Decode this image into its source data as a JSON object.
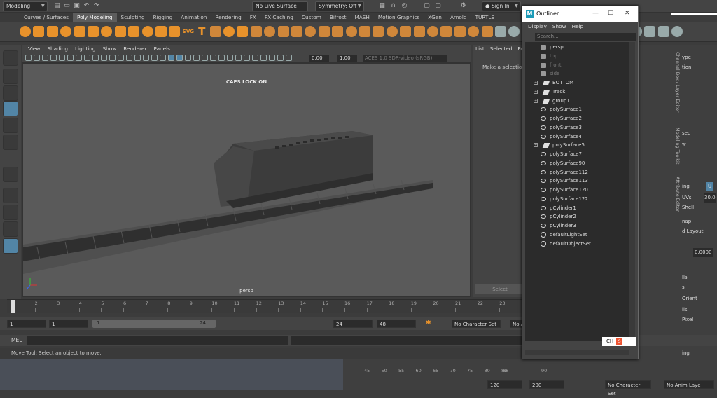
{
  "statusline": {
    "workspace": "Modeling",
    "live_surface": "No Live Surface",
    "symmetry": "Symmetry: Off",
    "sign_in": "Sign In"
  },
  "shelf_tabs": [
    "Curves / Surfaces",
    "Poly Modeling",
    "Sculpting",
    "Rigging",
    "Animation",
    "Rendering",
    "FX",
    "FX Caching",
    "Custom",
    "Bifrost",
    "MASH",
    "Motion Graphics",
    "XGen",
    "Arnold",
    "TURTLE"
  ],
  "shelf_active": "Poly Modeling",
  "shelf_text_icons": [
    "T",
    "SVG"
  ],
  "viewport": {
    "menus": [
      "View",
      "Shading",
      "Lighting",
      "Show",
      "Renderer",
      "Panels"
    ],
    "exposure": "0.00",
    "gamma": "1.00",
    "color_space": "ACES 1.0 SDR-video (sRGB)",
    "caps_lock": "CAPS LOCK ON",
    "camera_label": "persp"
  },
  "attribute_panel": {
    "tabs": [
      "List",
      "Selected",
      "Fo"
    ],
    "message": "Make a selection",
    "select_button": "Select",
    "copy_tab_button": "y Tab"
  },
  "timeline": {
    "ticks": [
      "1",
      "2",
      "3",
      "4",
      "5",
      "6",
      "7",
      "8",
      "9",
      "10",
      "11",
      "12",
      "13",
      "14",
      "15",
      "16",
      "17",
      "18",
      "19",
      "20",
      "21",
      "22",
      "23"
    ],
    "current_frame": "1"
  },
  "range": {
    "start": "1",
    "anim_start": "1",
    "slider_start": "1",
    "slider_end": "24",
    "anim_end": "24",
    "end": "48",
    "character_set": "No Character Set",
    "anim_layer": "No A"
  },
  "command_line": {
    "label": "MEL"
  },
  "help_line": "Move Tool: Select an object to move.",
  "outliner": {
    "title": "Outliner",
    "menus": [
      "Display",
      "Show",
      "Help"
    ],
    "search_placeholder": "Search...",
    "items": [
      {
        "label": "persp",
        "icon": "camera-icon",
        "expand": false,
        "dim": false
      },
      {
        "label": "top",
        "icon": "camera-icon",
        "expand": false,
        "dim": true
      },
      {
        "label": "front",
        "icon": "camera-icon",
        "expand": false,
        "dim": true
      },
      {
        "label": "side",
        "icon": "camera-icon",
        "expand": false,
        "dim": true
      },
      {
        "label": "BOTTOM",
        "icon": "group-icon",
        "expand": true,
        "dim": false
      },
      {
        "label": "Track",
        "icon": "group-icon",
        "expand": true,
        "dim": false
      },
      {
        "label": "group1",
        "icon": "group-icon",
        "expand": true,
        "dim": false
      },
      {
        "label": "polySurface1",
        "icon": "mesh-icon",
        "expand": false,
        "dim": false
      },
      {
        "label": "polySurface2",
        "icon": "mesh-icon",
        "expand": false,
        "dim": false
      },
      {
        "label": "polySurface3",
        "icon": "mesh-icon",
        "expand": false,
        "dim": false
      },
      {
        "label": "polySurface4",
        "icon": "mesh-icon",
        "expand": false,
        "dim": false
      },
      {
        "label": "polySurface5",
        "icon": "group-icon",
        "expand": true,
        "dim": false
      },
      {
        "label": "polySurface7",
        "icon": "mesh-icon",
        "expand": false,
        "dim": false
      },
      {
        "label": "polySurface90",
        "icon": "mesh-icon",
        "expand": false,
        "dim": false
      },
      {
        "label": "polySurface112",
        "icon": "mesh-icon",
        "expand": false,
        "dim": false
      },
      {
        "label": "polySurface113",
        "icon": "mesh-icon",
        "expand": false,
        "dim": false
      },
      {
        "label": "polySurface120",
        "icon": "mesh-icon",
        "expand": false,
        "dim": false
      },
      {
        "label": "polySurface122",
        "icon": "mesh-icon",
        "expand": false,
        "dim": false
      },
      {
        "label": "pCylinder1",
        "icon": "mesh-icon",
        "expand": false,
        "dim": false
      },
      {
        "label": "pCylinder2",
        "icon": "mesh-icon",
        "expand": false,
        "dim": false
      },
      {
        "label": "pCylinder3",
        "icon": "mesh-icon",
        "expand": false,
        "dim": false
      },
      {
        "label": "defaultLightSet",
        "icon": "set-icon",
        "expand": false,
        "dim": false
      },
      {
        "label": "defaultObjectSet",
        "icon": "set-icon",
        "expand": false,
        "dim": false
      }
    ],
    "ime_label": "CH"
  },
  "right_dock": {
    "rows": [
      "ype",
      "tion",
      "sed",
      "w",
      "ing",
      "UVs",
      "Shell",
      "nap",
      "d Layout",
      "0.0000",
      "lls",
      "s",
      "Orient",
      "lls",
      "Pixel",
      "ing"
    ],
    "uv_value": "30.0",
    "u_label": "U",
    "uv_sets": "UV Sets",
    "side_tabs": [
      "Channel Box / Layer Editor",
      "Modeling Toolkit",
      "Attribute Editor"
    ]
  },
  "window2": {
    "ticks": [
      "45",
      "50",
      "55",
      "60",
      "65",
      "70",
      "75",
      "80",
      "85",
      "88",
      "90"
    ],
    "fields": [
      "120",
      "200"
    ],
    "character_set": "No Character Set",
    "anim_layer": "No Anim Laye"
  },
  "colors": {
    "accent": "#5285a6",
    "shelf_orange": "#e8922b",
    "viewport_bg": "#5a5a5a"
  }
}
